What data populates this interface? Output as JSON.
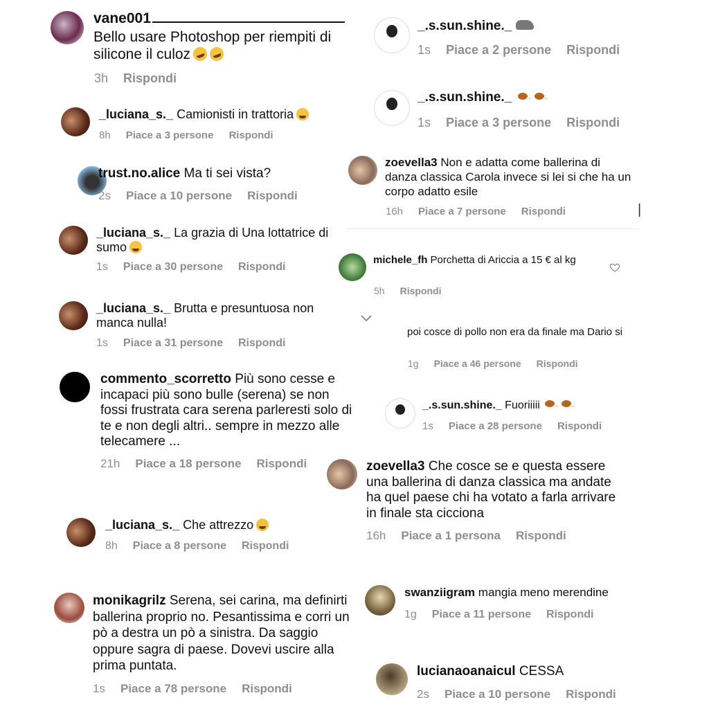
{
  "left": [
    {
      "user": "vane001",
      "text": "Bello usare Photoshop per riempiti di silicone il culoz",
      "time": "3h",
      "likes": "",
      "reply": "Rispondi",
      "emoji": "rolling-laughing-face x2"
    },
    {
      "user": "_luciana_s._",
      "text": "Camionisti in trattoria",
      "time": "8h",
      "likes": "Piace a 3 persone",
      "reply": "Rispondi",
      "emoji": "tears-of-joy-face"
    },
    {
      "user": "trust.no.alice",
      "text": "Ma ti sei vista?",
      "time": "2s",
      "likes": "Piace a 10 persone",
      "reply": "Rispondi"
    },
    {
      "user": "_luciana_s._",
      "text": "La grazia di Una lottatrice di sumo",
      "time": "1s",
      "likes": "Piace a 30 persone",
      "reply": "Rispondi",
      "emoji": "tears-of-joy-face"
    },
    {
      "user": "_luciana_s._",
      "text": "Brutta e presuntuosa non manca nulla!",
      "time": "1s",
      "likes": "Piace a 31 persone",
      "reply": "Rispondi"
    },
    {
      "user": "commento_scorretto",
      "text": "Più sono cesse e incapaci più sono bulle (serena) se non fossi frustrata cara serena parleresti solo di te e non degli altri.. sempre in mezzo alle telecamere ...",
      "time": "21h",
      "likes": "Piace a 18 persone",
      "reply": "Rispondi"
    },
    {
      "user": "_luciana_s._",
      "text": "Che attrezzo",
      "time": "8h",
      "likes": "Piace a 8 persone",
      "reply": "Rispondi",
      "emoji": "person-facepalming"
    },
    {
      "user": "monikagrilz",
      "text": "Serena, sei carina, ma definirti ballerina proprio no. Pesantissima e corri un pò a destra un pò a sinistra. Da saggio oppure sagra di paese. Dovevi uscire alla prima puntata.",
      "time": "1s",
      "likes": "Piace a 78 persone",
      "reply": "Rispondi"
    }
  ],
  "right": [
    {
      "user": "_.s.sun.shine._",
      "text": "",
      "time": "1s",
      "likes": "Piace a 2 persone",
      "reply": "Rispondi",
      "emoji": "rhinoceros"
    },
    {
      "user": "_.s.sun.shine._",
      "text": "",
      "time": "1s",
      "likes": "Piace a 3 persone",
      "reply": "Rispondi",
      "emoji": "poultry-leg x2"
    },
    {
      "user": "zoevella3",
      "text": "Non e adatta come ballerina di danza classica Carola invece si lei si che ha un corpo adatto esile",
      "time": "16h",
      "likes": "Piace a 7 persone",
      "reply": "Rispondi"
    },
    {
      "user": "michele_fh",
      "text": "Porchetta di Ariccia a 15 € al kg",
      "time": "5h",
      "likes": "",
      "reply": "Rispondi"
    },
    {
      "user": "",
      "text": "poi cosce di pollo non era da finale ma Dario si",
      "time": "1g",
      "likes": "Piace a 46 persone",
      "reply": "Rispondi"
    },
    {
      "user": "_.s.sun.shine._",
      "text": "Fuoriiiii",
      "time": "1s",
      "likes": "Piace a 28 persone",
      "reply": "Rispondi",
      "emoji": "poultry-leg x2"
    },
    {
      "user": "zoevella3",
      "text": "Che cosce se e questa essere una ballerina  di danza classica ma andate ha quel paese chi ha votato a farla arrivare  in finale sta cicciona",
      "time": "16h",
      "likes": "Piace a 1 persona",
      "reply": "Rispondi"
    },
    {
      "user": "swanziigram",
      "text": "mangia meno merendine",
      "time": "1g",
      "likes": "Piace a 11 persone",
      "reply": "Rispondi"
    },
    {
      "user": "lucianaoanaicul",
      "text": "CESSA",
      "time": "2s",
      "likes": "Piace a 10 persone",
      "reply": "Rispondi"
    }
  ],
  "icons": {
    "like": "heart-outline-icon",
    "expand": "chevron-down-icon",
    "edge": "cursor-bar"
  },
  "colors": {
    "text": "#111111",
    "meta": "#8e8e8e",
    "background": "#ffffff"
  }
}
